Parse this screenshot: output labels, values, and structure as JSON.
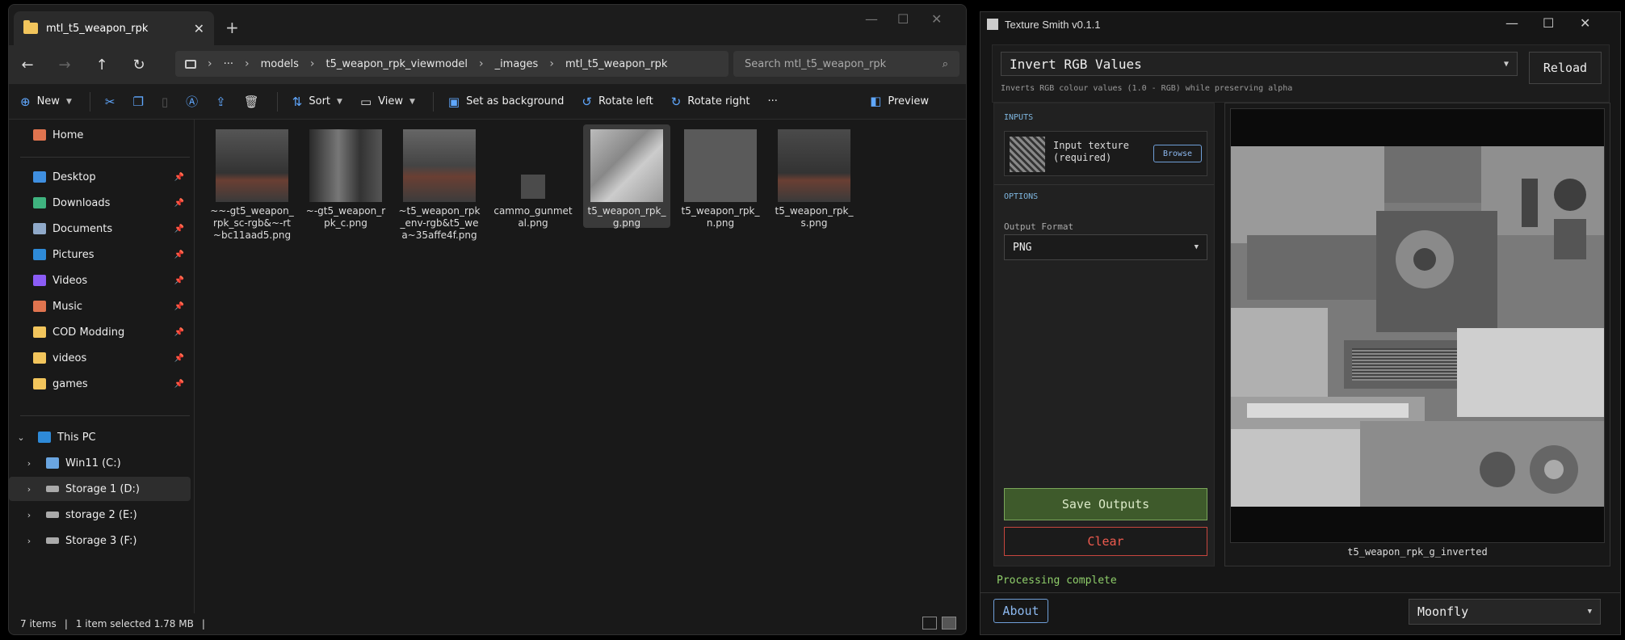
{
  "explorer": {
    "tab_title": "mtl_t5_weapon_rpk",
    "breadcrumb": [
      "···",
      "models",
      "t5_weapon_rpk_viewmodel",
      "_images",
      "mtl_t5_weapon_rpk"
    ],
    "search_placeholder": "Search mtl_t5_weapon_rpk",
    "commands": {
      "new": "New",
      "sort": "Sort",
      "view": "View",
      "set_bg": "Set as background",
      "rotate_left": "Rotate left",
      "rotate_right": "Rotate right",
      "more": "···",
      "preview": "Preview"
    },
    "sidebar": {
      "home": "Home",
      "quick": [
        {
          "label": "Desktop",
          "color": "#3f8fe0"
        },
        {
          "label": "Downloads",
          "color": "#3fb37f"
        },
        {
          "label": "Documents",
          "color": "#8fa9c9"
        },
        {
          "label": "Pictures",
          "color": "#2e8ad8"
        },
        {
          "label": "Videos",
          "color": "#8b5cf6"
        },
        {
          "label": "Music",
          "color": "#e0744f"
        },
        {
          "label": "COD Modding",
          "color": "#f2c55c"
        },
        {
          "label": "videos",
          "color": "#f2c55c"
        },
        {
          "label": "games",
          "color": "#f2c55c"
        }
      ],
      "this_pc": "This PC",
      "drives": [
        "Win11 (C:)",
        "Storage 1 (D:)",
        "storage 2 (E:)",
        "Storage 3 (F:)"
      ]
    },
    "files": [
      "~~-gt5_weapon_rpk_sc-rgb&~-rt~bc11aad5.png",
      "~-gt5_weapon_rpk_c.png",
      "~t5_weapon_rpk_env-rgb&t5_wea~35affe4f.png",
      "cammo_gunmetal.png",
      "t5_weapon_rpk_g.png",
      "t5_weapon_rpk_n.png",
      "t5_weapon_rpk_s.png"
    ],
    "status": {
      "items": "7 items",
      "selected": "1 item selected  1.78 MB"
    }
  },
  "texture_smith": {
    "title": "Texture Smith v0.1.1",
    "operation": "Invert RGB Values",
    "operation_desc": "Inverts RGB colour values (1.0 - RGB) while preserving alpha",
    "reload": "Reload",
    "inputs_label": "INPUTS",
    "input_texture_label": "Input texture (required)",
    "browse": "Browse",
    "options_label": "OPTIONS",
    "output_format_label": "Output Format",
    "output_format": "PNG",
    "save": "Save Outputs",
    "clear": "Clear",
    "preview_caption": "t5_weapon_rpk_g_inverted",
    "status": "Processing complete",
    "about": "About",
    "theme": "Moonfly"
  }
}
